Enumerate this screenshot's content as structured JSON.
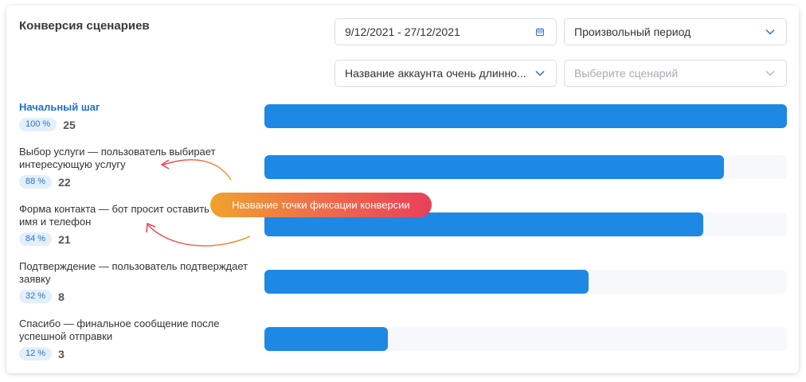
{
  "widget": {
    "title": "Конверсия сценариев"
  },
  "filters": {
    "date_range": "9/12/2021 - 27/12/2021",
    "period": "Произвольный период",
    "account": "Название аккаунта очень длинно...",
    "scenario_placeholder": "Выберите сценарий"
  },
  "steps": [
    {
      "label": "Начальный шаг",
      "percent_label": "100 %",
      "count": "25",
      "fill": 1.0
    },
    {
      "label": "Выбор услуги — пользователь выбирает интересующую услугу",
      "percent_label": "88 %",
      "count": "22",
      "fill": 0.88
    },
    {
      "label": "Форма контакта — бот просит оставить имя и телефон",
      "percent_label": "84 %",
      "count": "21",
      "fill": 0.84
    },
    {
      "label": "Подтверждение — пользователь подтверждает заявку",
      "percent_label": "32 %",
      "count": "8",
      "fill": 0.62
    },
    {
      "label": "Спасибо — финальное сообщение после успешной отправки",
      "percent_label": "12 %",
      "count": "3",
      "fill": 0.236
    }
  ],
  "tooltip": {
    "text": "Название точки фиксации конверсии"
  },
  "colors": {
    "bar": "#1e88e5",
    "track": "#f7f8fb",
    "first_step_label": "#1f6fcf",
    "badge_bg": "#e2effd",
    "tooltip_gradient_start": "#f0a22e",
    "tooltip_gradient_end": "#e84058"
  },
  "icons": {
    "date": "calendar-icon",
    "dropdown": "chevron-down-icon"
  }
}
